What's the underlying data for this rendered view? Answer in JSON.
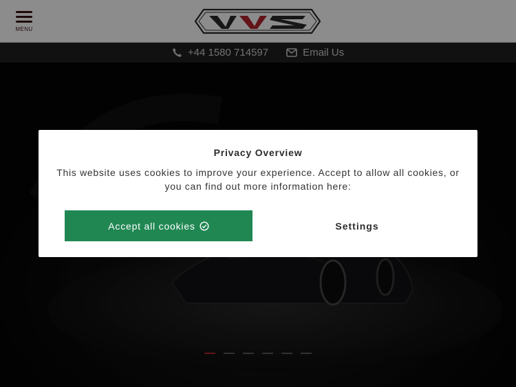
{
  "header": {
    "menu_label": "MENU",
    "logo_text": "VVS"
  },
  "contact": {
    "phone": "+44 1580 714597",
    "email_label": "Email Us"
  },
  "hero": {
    "slide_count": 6,
    "active_slide": 1
  },
  "cookie_modal": {
    "title": "Privacy Overview",
    "text": "This website uses cookies to improve your experience. Accept to allow all cookies, or you can find out more information here:",
    "accept_label": "Accept all cookies",
    "settings_label": "Settings"
  },
  "colors": {
    "brand_dark": "#3a1114",
    "brand_red": "#b3262d",
    "accept_green": "#208753"
  },
  "icons": [
    "hamburger-icon",
    "phone-icon",
    "envelope-icon",
    "check-circle-icon"
  ]
}
